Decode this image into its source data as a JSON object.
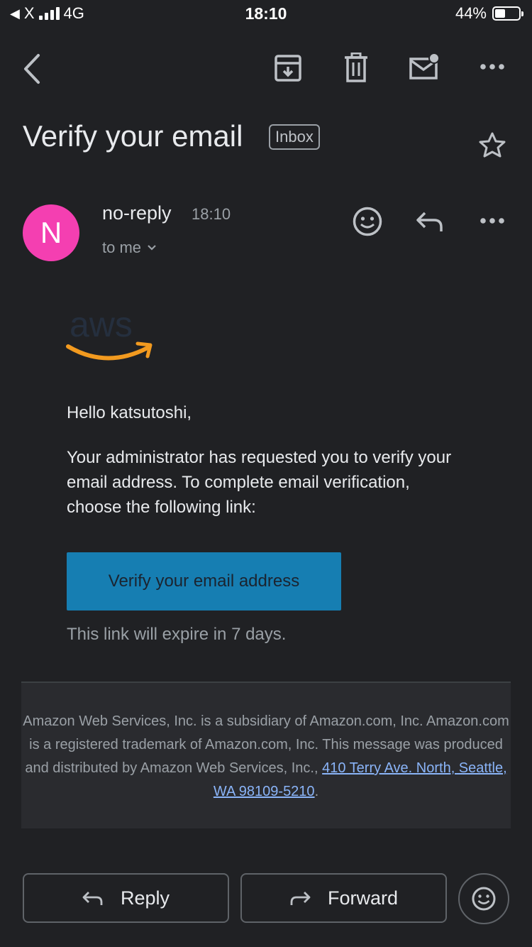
{
  "status_bar": {
    "carrier": "X",
    "network": "4G",
    "time": "18:10",
    "battery": "44%",
    "battery_fraction": 0.44
  },
  "toolbar": {
    "back_icon": "chevron-left-icon",
    "archive_icon": "archive-icon",
    "delete_icon": "trash-icon",
    "mark_unread_icon": "mail-unread-icon",
    "more_icon": "more-horizontal-icon"
  },
  "email": {
    "subject": "Verify your email",
    "label": "Inbox",
    "sender": "no-reply",
    "time": "18:10",
    "recipient": "to me",
    "avatar_letter": "N",
    "avatar_color": "#f43fb1"
  },
  "message": {
    "logo_text": "aws",
    "greeting": "Hello katsutoshi,",
    "paragraph": "Your administrator has requested you to verify your email address. To complete email verification, choose the following link:",
    "button_label": "Verify your email address",
    "expiry": "This link will expire in 7 days.",
    "footer_text": "Amazon Web Services, Inc. is a subsidiary of Amazon.com, Inc. Amazon.com is a registered trademark of Amazon.com, Inc. This message was produced and distributed by Amazon Web Services, Inc.,",
    "footer_address": "410 Terry Ave. North, Seattle, WA 98109-5210",
    "footer_end": "."
  },
  "actions": {
    "reply_label": "Reply",
    "forward_label": "Forward"
  },
  "colors": {
    "background": "#202124",
    "button": "#167eb2",
    "link": "#8ab4f8",
    "aws_orange": "#f29a1f"
  }
}
